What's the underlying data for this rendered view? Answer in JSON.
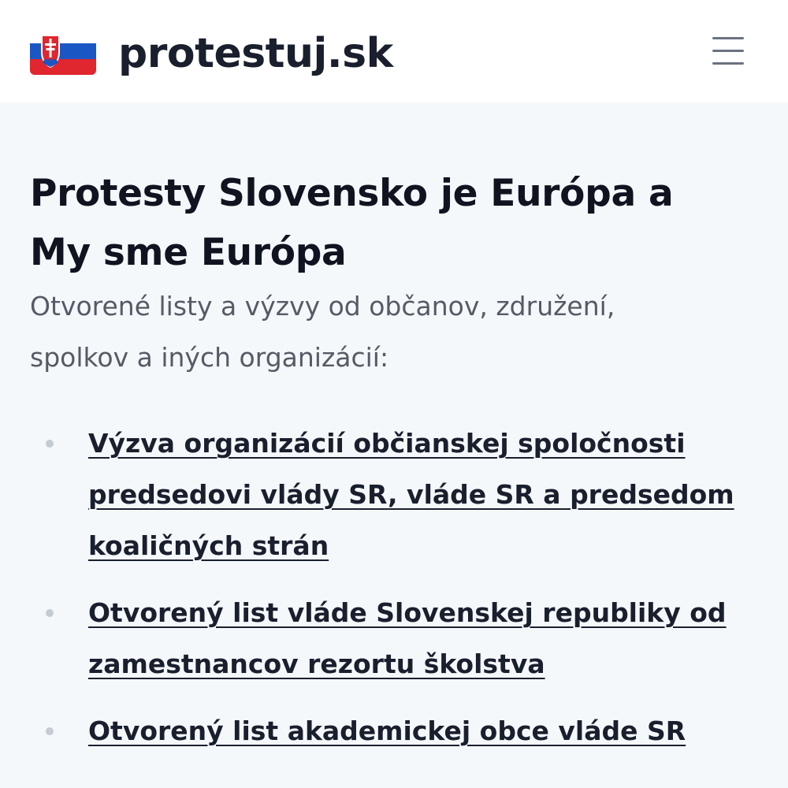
{
  "header": {
    "site_name": "protestuj.sk",
    "flag_icon": "slovakia-flag-icon",
    "menu_icon": "hamburger-menu-icon"
  },
  "main": {
    "title": "Protesty Slovensko je Európa a My sme Európa",
    "subtitle": "Otvorené listy a výzvy od občanov, združení, spolkov a iných organizácií:",
    "letters": [
      {
        "label": "Výzva organizácií občianskej spoločnosti predsedovi vlády SR, vláde SR a predsedom koaličných strán"
      },
      {
        "label": "Otvorený list vláde Slovenskej republiky od zamestnancov rezortu školstva"
      },
      {
        "label": "Otvorený list akademickej obce vláde SR"
      }
    ]
  },
  "colors": {
    "background": "#f5f8fa",
    "header_background": "#ffffff",
    "text": "#1a1f2e",
    "muted_text": "#555b66",
    "bullet": "#c5cbd2",
    "flag_white": "#ffffff",
    "flag_blue": "#1a56c4",
    "flag_red": "#e0262f"
  }
}
